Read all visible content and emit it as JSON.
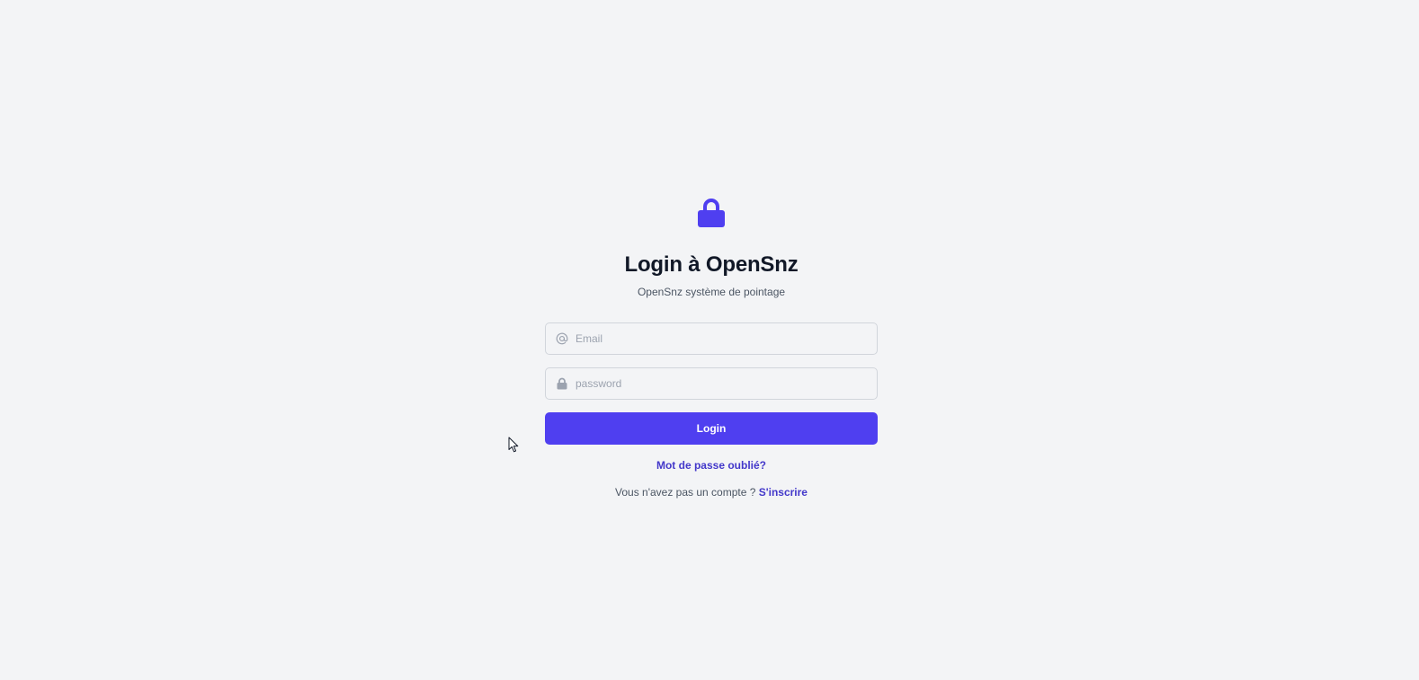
{
  "header": {
    "logo_icon": "lock-icon",
    "title": "Login à OpenSnz",
    "subtitle": "OpenSnz système de pointage"
  },
  "form": {
    "email": {
      "icon": "at-sign-icon",
      "placeholder": "Email",
      "value": ""
    },
    "password": {
      "icon": "lock-icon",
      "placeholder": "password",
      "value": ""
    },
    "submit_label": "Login"
  },
  "links": {
    "forgot_password": "Mot de passe oublié?",
    "no_account_text": "Vous n'avez pas un compte ?",
    "signup_label": "S'inscrire"
  },
  "colors": {
    "background": "#f3f4f6",
    "accent": "#4f3ff0",
    "link": "#4338ca",
    "title": "#111827",
    "muted_text": "#4b5563",
    "input_border": "#d1d5db",
    "icon_muted": "#9ca3af"
  }
}
